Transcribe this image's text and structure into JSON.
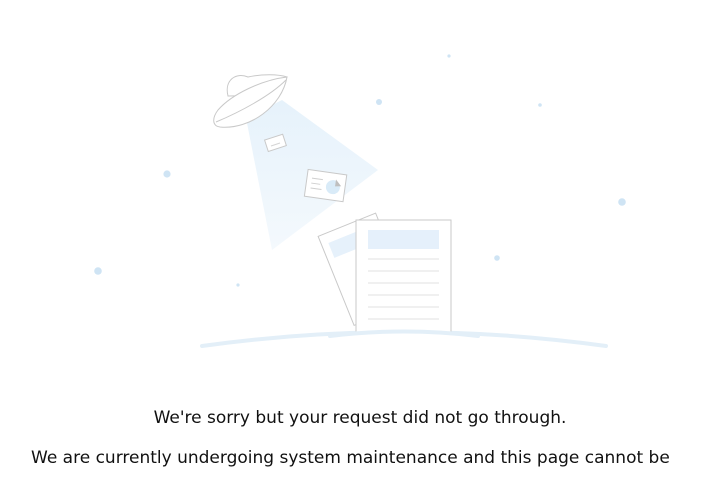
{
  "message": {
    "headline": "We're sorry but your request did not go through.",
    "detail": "We are currently undergoing system maintenance and this page cannot be"
  },
  "illustration": {
    "icon": "ufo-maintenance-illustration",
    "accent_color": "#cfe6f7",
    "outline_color": "#c9c9c9"
  }
}
